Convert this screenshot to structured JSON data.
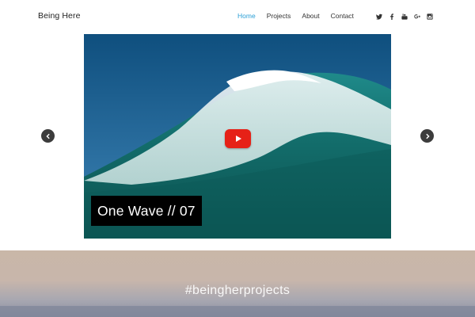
{
  "header": {
    "logo": "Being Here",
    "nav": [
      {
        "label": "Home",
        "active": true
      },
      {
        "label": "Projects",
        "active": false
      },
      {
        "label": "About",
        "active": false
      },
      {
        "label": "Contact",
        "active": false
      }
    ],
    "social_icons": [
      "twitter-icon",
      "facebook-icon",
      "youtube-icon",
      "google-plus-icon",
      "instagram-icon"
    ]
  },
  "slider": {
    "caption": "One Wave // 07",
    "play_icon": "youtube-play-icon",
    "prev_icon": "chevron-left-icon",
    "next_icon": "chevron-right-icon"
  },
  "banner": {
    "hashtag": "#beingherprojects"
  },
  "colors": {
    "accent": "#2a9fd6",
    "play_red": "#e62117",
    "caption_bg": "#000000",
    "arrow_bg": "#3c3c3c"
  }
}
